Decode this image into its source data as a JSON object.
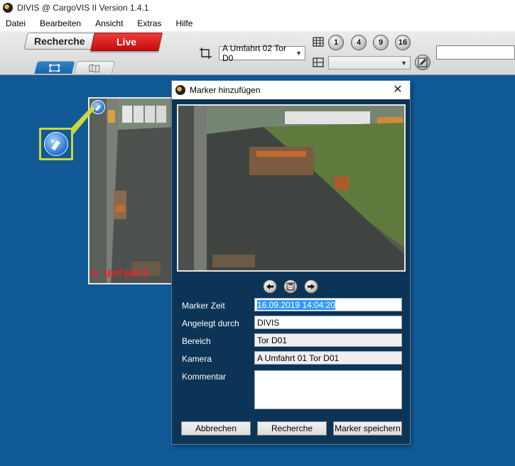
{
  "window": {
    "title": "DIVIS @ CargoVIS II Version 1.4.1"
  },
  "menu": [
    "Datei",
    "Bearbeiten",
    "Ansicht",
    "Extras",
    "Hilfe"
  ],
  "toolbar": {
    "mode_recherche": "Recherche",
    "mode_live": "Live",
    "active_mode": "Live",
    "camera_select_value": "A Umfahrt 02 Tor D0",
    "layout_buttons": [
      "1",
      "4",
      "9",
      "16"
    ],
    "layout_select_value": "",
    "search_value": ""
  },
  "camera_tile": {
    "label": "A Umfahrt"
  },
  "dialog": {
    "title": "Marker hinzufügen",
    "fields": {
      "marker_zeit_label": "Marker Zeit",
      "marker_zeit_value": "16.09.2019 14:04:20",
      "angelegt_label": "Angelegt durch",
      "angelegt_value": "DIVIS",
      "bereich_label": "Bereich",
      "bereich_value": "Tor D01",
      "kamera_label": "Kamera",
      "kamera_value": "A Umfahrt 01 Tor D01",
      "kommentar_label": "Kommentar",
      "kommentar_value": ""
    },
    "buttons": {
      "cancel": "Abbrechen",
      "research": "Recherche",
      "save": "Marker speichern"
    }
  },
  "colors": {
    "background": "#0f5a97",
    "dialog_bg": "#0c3456",
    "live_red": "#d41c1c",
    "callout_border": "#c9d83a",
    "selection": "#3399ff"
  },
  "icons": [
    "app-icon",
    "crop-icon",
    "grid-icon",
    "layout-list-icon",
    "edit-icon",
    "fullscreen-icon",
    "map-icon",
    "marker-icon",
    "close-icon",
    "arrow-left-icon",
    "save-icon",
    "arrow-right-icon"
  ]
}
